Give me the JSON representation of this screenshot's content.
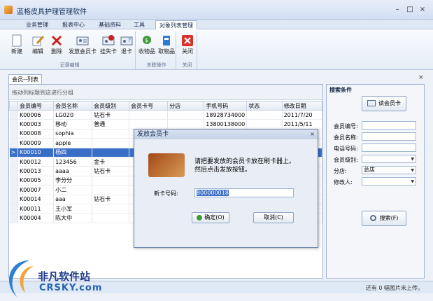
{
  "window": {
    "title": "蓝格皮具护理管理软件",
    "min_label": "–",
    "max_label": "□",
    "close_label": "×"
  },
  "menu": {
    "items": [
      "业务管理",
      "报表中心",
      "基础资料",
      "工具",
      "对象列表管理"
    ],
    "active_index": 4
  },
  "ribbon": {
    "groups": [
      {
        "label": "记录编辑",
        "buttons": [
          "新建",
          "编辑",
          "删除",
          "发放会员卡",
          "挂失卡",
          "退卡"
        ]
      },
      {
        "label": "关联操作",
        "buttons": [
          "收物品",
          "取物品"
        ]
      },
      {
        "label": "关闭",
        "buttons": [
          "关闭"
        ]
      }
    ]
  },
  "document_tab": {
    "label": "会员--列表",
    "close_label": "×"
  },
  "grid": {
    "group_hint": "拖动列标题到这进行分组",
    "columns": [
      "会员编号",
      "会员名称",
      "会员级别",
      "会员卡号",
      "分店",
      "手机号码",
      "状态",
      "修改日期"
    ],
    "rows": [
      [
        "K00006",
        "LG020",
        "钻石卡",
        "",
        "",
        "18928734000",
        "",
        "2011/7/20"
      ],
      [
        "K00003",
        "移动",
        "普通",
        "",
        "",
        "13800138000",
        "",
        "2011/5/11"
      ],
      [
        "K00008",
        "sophia",
        "",
        "",
        "",
        "",
        "",
        ""
      ],
      [
        "K00009",
        "apple",
        "",
        "",
        "",
        "",
        "",
        ""
      ],
      [
        "K00010",
        "杨四",
        "",
        "",
        "",
        "",
        "",
        ""
      ],
      [
        "K00012",
        "123456",
        "金卡",
        "",
        "",
        "",
        "",
        ""
      ],
      [
        "K00013",
        "aaaa",
        "钻石卡",
        "",
        "",
        "",
        "",
        ""
      ],
      [
        "K00005",
        "李分分",
        "",
        "",
        "",
        "",
        "",
        ""
      ],
      [
        "K00007",
        "小二",
        "",
        "",
        "",
        "",
        "",
        ""
      ],
      [
        "K00014",
        "aaa",
        "钻石卡",
        "",
        "",
        "",
        "",
        ""
      ],
      [
        "K00011",
        "王小军",
        "",
        "",
        "",
        "",
        "",
        ""
      ],
      [
        "K00004",
        "陈大中",
        "",
        "",
        "",
        "",
        "",
        ""
      ]
    ],
    "selected_row": 4,
    "row_marker": ">"
  },
  "search": {
    "title": "搜索条件",
    "read_card_label": "读会员卡",
    "fields": [
      {
        "label": "会员编号:",
        "value": "",
        "dropdown": false
      },
      {
        "label": "会员名称:",
        "value": "",
        "dropdown": false
      },
      {
        "label": "电话号码:",
        "value": "",
        "dropdown": false
      },
      {
        "label": "会员级别:",
        "value": "",
        "dropdown": true
      },
      {
        "label": "分店:",
        "value": "总店",
        "dropdown": true
      },
      {
        "label": "修改人:",
        "value": "",
        "dropdown": true
      }
    ],
    "search_button_label": "搜索(F)"
  },
  "dialog": {
    "title": "发放会员卡",
    "close_label": "×",
    "message_line1": "请把要发放的会员卡放在刷卡器上。",
    "message_line2": "然后点击发放按钮。",
    "card_field_label": "新卡号码:",
    "card_field_value": "800000018",
    "ok_label": "确定(O)",
    "cancel_label": "取消(C)"
  },
  "status": {
    "text": "还有 0 幅图片未上传。"
  },
  "watermark": {
    "name": "非凡软件站",
    "domain": "CRSKY.com"
  },
  "colors": {
    "selection": "#3a6ec6",
    "close_red": "#d9302b",
    "accent": "#15294a"
  }
}
